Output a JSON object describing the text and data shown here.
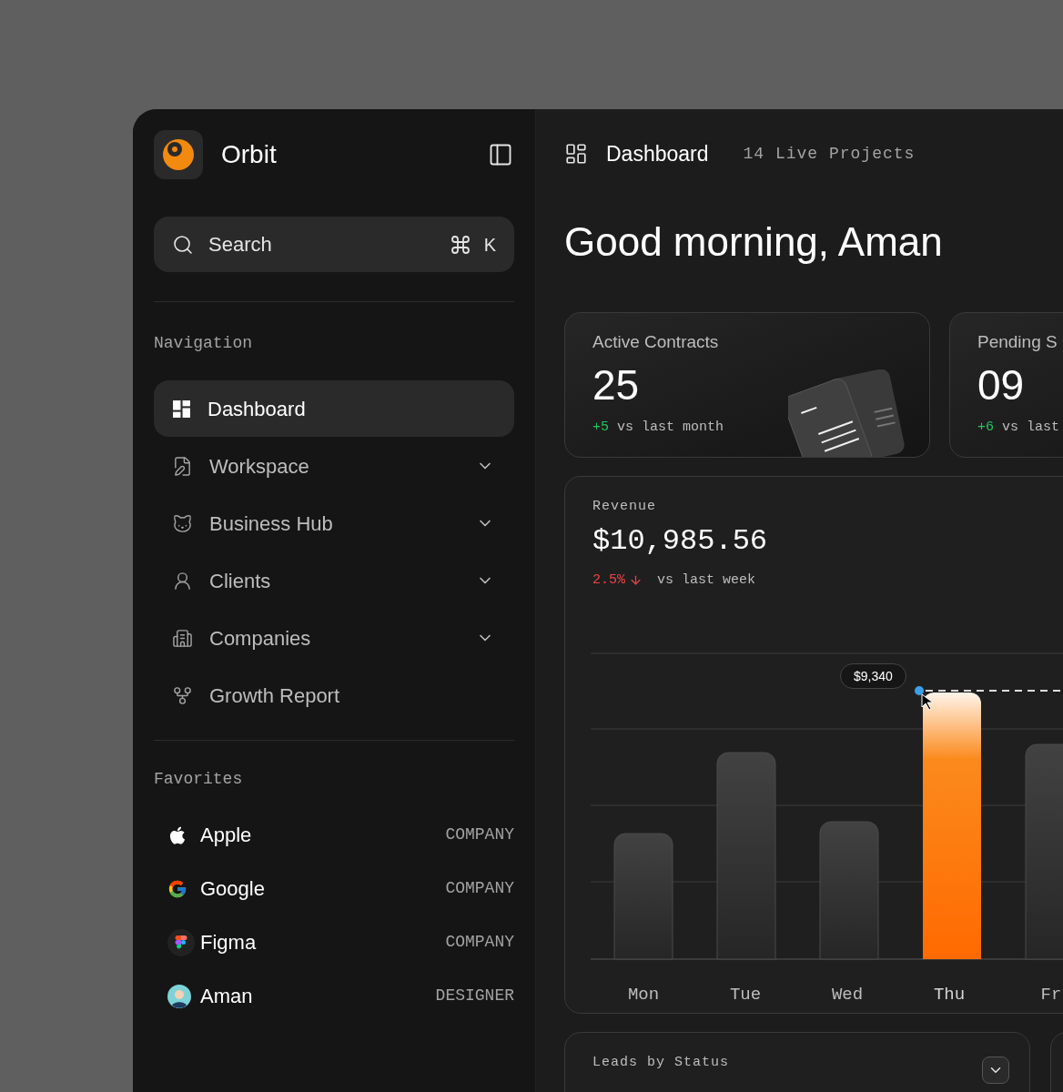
{
  "sidebar": {
    "brand": "Orbit",
    "search": {
      "placeholder": "Search",
      "shortcut_key": "K"
    },
    "nav_heading": "Navigation",
    "nav_items": [
      {
        "label": "Dashboard",
        "kind": "link",
        "selected": true
      },
      {
        "label": "Workspace",
        "kind": "group",
        "selected": false
      },
      {
        "label": "Business Hub",
        "kind": "group",
        "selected": false
      },
      {
        "label": "Clients",
        "kind": "group",
        "selected": false
      },
      {
        "label": "Companies",
        "kind": "group",
        "selected": false
      },
      {
        "label": "Growth Report",
        "kind": "link",
        "selected": false
      }
    ],
    "favorites_heading": "Favorites",
    "favorites": [
      {
        "name": "Apple",
        "tag": "COMPANY"
      },
      {
        "name": "Google",
        "tag": "COMPANY"
      },
      {
        "name": "Figma",
        "tag": "COMPANY"
      },
      {
        "name": "Aman",
        "tag": "DESIGNER"
      }
    ]
  },
  "header": {
    "title": "Dashboard",
    "subtitle": "14 Live Projects"
  },
  "greeting": "Good morning, Aman",
  "stats": [
    {
      "title": "Active Contracts",
      "value": "25",
      "delta": "+5",
      "negative": false,
      "note": "vs last month"
    },
    {
      "title": "Pending S",
      "value": "09",
      "delta": "+6",
      "negative": false,
      "note": "vs last"
    }
  ],
  "revenue": {
    "title": "Revenue",
    "amount": "$10,985.56",
    "change": "2.5%",
    "negative": true,
    "note": "vs last week",
    "tooltip": "$9,340",
    "days": [
      {
        "label": "Mon",
        "selected": false
      },
      {
        "label": "Tue",
        "selected": false
      },
      {
        "label": "Wed",
        "selected": false
      },
      {
        "label": "Thu",
        "selected": true
      },
      {
        "label": "Fr",
        "selected": false
      }
    ]
  },
  "leads": {
    "title": "Leads by Status"
  }
}
